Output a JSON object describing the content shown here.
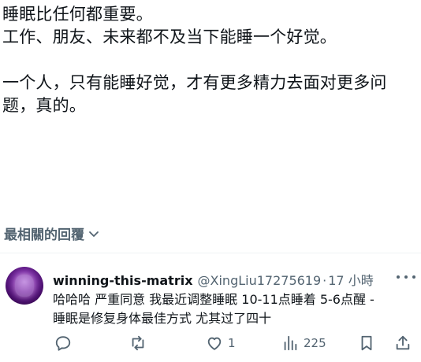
{
  "post": {
    "line1": "睡眠比任何都重要。",
    "line2": "工作、朋友、未来都不及当下能睡一个好觉。",
    "line3": "一个人，只有能睡好觉，才有更多精力去面对更多问",
    "line4": "题，真的。"
  },
  "replies_sort": {
    "label": "最相關的回覆",
    "icon": "chevron-down-icon"
  },
  "reply": {
    "name": "winning-this-matrix",
    "handle": "@XingLiu17275619",
    "separator": "·",
    "time": "17 小時",
    "text_line1": "哈哈哈 严重同意 我最近调整睡眠 10-11点睡着 5-6点醒 -",
    "text_line2": "睡眠是修复身体最佳方式 尤其过了四十",
    "likes": "1",
    "views": "225"
  },
  "colors": {
    "text": "#0f1419",
    "secondary": "#536471",
    "divider": "#eff3f4"
  }
}
